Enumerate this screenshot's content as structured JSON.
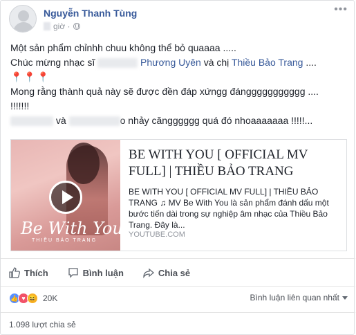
{
  "post": {
    "author": "Nguyễn Thanh Tùng",
    "time_suffix": "giờ ·",
    "lines": {
      "l1": "Một sản phẩm chỉnhh chuu không thể bỏ quaaaa .....",
      "l2_prefix": "Chúc mừng nhạc sĩ",
      "l2_link1": "Phương Uyên",
      "l2_mid": "và chị",
      "l2_link2": "Thiều Bảo Trang",
      "l2_suffix": "....",
      "l3_pins": "📍📍📍",
      "l4": "Mong rằng thành quả này sẽ được đền đáp xứngg đánggggggggggg ....",
      "l5": "!!!!!!!",
      "l6_mid": "và",
      "l6_suffix": "o nhảy căngggggg quá đó nhoaaaaaaa !!!!!..."
    }
  },
  "share": {
    "title": "BE WITH YOU [ OFFICIAL MV FULL] | THIỀU BẢO TRANG",
    "description": "BE WITH YOU [ OFFICIAL MV FULL] | THIỀU BẢO TRANG ♫ MV Be With You là sản phẩm đánh dấu một bước tiến dài trong sự nghiệp âm nhạc của Thiều Bảo Trang. Đây là...",
    "domain": "YOUTUBE.COM",
    "thumb_script": "Be With You",
    "thumb_sub": "THIỀU BẢO TRANG"
  },
  "actions": {
    "like": "Thích",
    "comment": "Bình luận",
    "share": "Chia sẻ"
  },
  "stats": {
    "reactions_count": "20K",
    "sort_label": "Bình luận liên quan nhất",
    "shares": "1.098 lượt chia sẻ"
  },
  "colors": {
    "link": "#365899",
    "like": "#5890ff",
    "love": "#f25268",
    "haha": "#f7b125"
  }
}
